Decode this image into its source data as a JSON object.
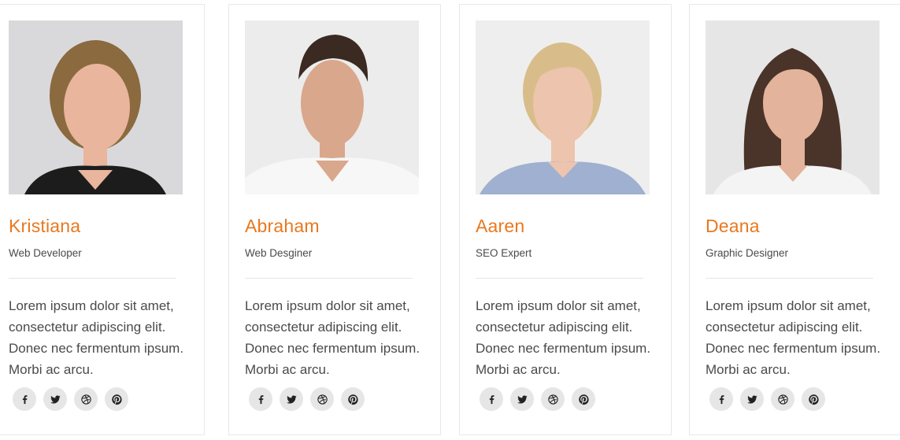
{
  "members": [
    {
      "name": "Kristiana",
      "role": "Web Developer",
      "bio": "Lorem ipsum dolor sit amet, consectetur adipiscing elit. Donec nec fermentum ipsum. Morbi ac arcu.",
      "photo": {
        "bg": "#d9d9dc",
        "hair": "#8a6a3e",
        "skin": "#e9b59c",
        "top": "#1c1c1c"
      }
    },
    {
      "name": "Abraham",
      "role": "Web Desginer",
      "bio": "Lorem ipsum dolor sit amet, consectetur adipiscing elit. Donec nec fermentum ipsum. Morbi ac arcu.",
      "photo": {
        "bg": "#ececec",
        "hair": "#3a2a22",
        "skin": "#d9a78c",
        "top": "#f7f7f7"
      }
    },
    {
      "name": "Aaren",
      "role": "SEO Expert",
      "bio": "Lorem ipsum dolor sit amet, consectetur adipiscing elit. Donec nec fermentum ipsum. Morbi ac arcu.",
      "photo": {
        "bg": "#eeeeee",
        "hair": "#d8bd8a",
        "skin": "#edc4ad",
        "top": "#9fb0d0"
      }
    },
    {
      "name": "Deana",
      "role": "Graphic Designer",
      "bio": "Lorem ipsum dolor sit amet, consectetur adipiscing elit. Donec nec fermentum ipsum. Morbi ac arcu.",
      "photo": {
        "bg": "#e6e6e6",
        "hair": "#4a3328",
        "skin": "#e3b39b",
        "top": "#f4f4f4"
      }
    }
  ],
  "social_icons": [
    "facebook-icon",
    "twitter-icon",
    "dribbble-icon",
    "pinterest-icon"
  ],
  "colors": {
    "accent": "#e8781e",
    "text": "#4a4a4a",
    "icon_bg": "#e6e6e6",
    "border": "#e8e8e8"
  }
}
